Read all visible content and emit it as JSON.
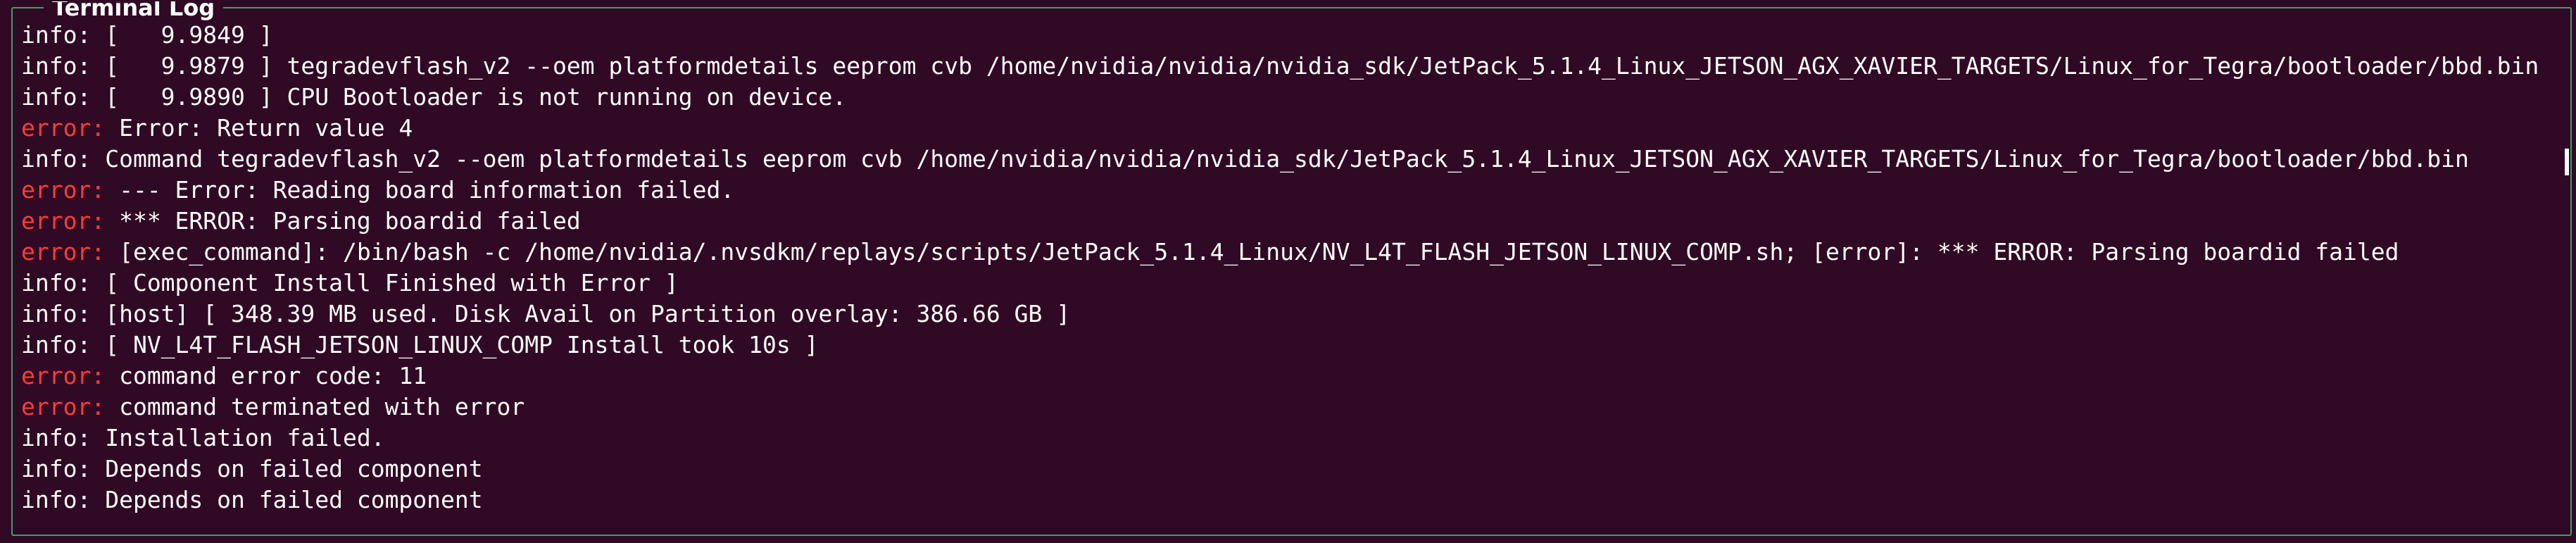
{
  "panel": {
    "title": "Terminal Log"
  },
  "colors": {
    "background": "#300a24",
    "frame_border": "#3a9f6e",
    "info_prefix": "#ffffff",
    "error_prefix": "#ff3b3b",
    "text": "#ffffff"
  },
  "log": {
    "lines": [
      {
        "level": "info",
        "prefix": "info:",
        "text": " [   9.9849 ]"
      },
      {
        "level": "info",
        "prefix": "info:",
        "text": " [   9.9879 ] tegradevflash_v2 --oem platformdetails eeprom cvb /home/nvidia/nvidia/nvidia_sdk/JetPack_5.1.4_Linux_JETSON_AGX_XAVIER_TARGETS/Linux_for_Tegra/bootloader/bbd.bin"
      },
      {
        "level": "info",
        "prefix": "info:",
        "text": " [   9.9890 ] CPU Bootloader is not running on device."
      },
      {
        "level": "error",
        "prefix": "error:",
        "text": " Error: Return value 4"
      },
      {
        "level": "info",
        "prefix": "info:",
        "text": " Command tegradevflash_v2 --oem platformdetails eeprom cvb /home/nvidia/nvidia/nvidia_sdk/JetPack_5.1.4_Linux_JETSON_AGX_XAVIER_TARGETS/Linux_for_Tegra/bootloader/bbd.bin"
      },
      {
        "level": "error",
        "prefix": "error:",
        "text": " --- Error: Reading board information failed."
      },
      {
        "level": "error",
        "prefix": "error:",
        "text": " *** ERROR: Parsing boardid failed"
      },
      {
        "level": "error",
        "prefix": "error:",
        "text": " [exec_command]: /bin/bash -c /home/nvidia/.nvsdkm/replays/scripts/JetPack_5.1.4_Linux/NV_L4T_FLASH_JETSON_LINUX_COMP.sh; [error]: *** ERROR: Parsing boardid failed"
      },
      {
        "level": "info",
        "prefix": "info:",
        "text": " [ Component Install Finished with Error ]"
      },
      {
        "level": "info",
        "prefix": "info:",
        "text": " [host] [ 348.39 MB used. Disk Avail on Partition overlay: 386.66 GB ]"
      },
      {
        "level": "info",
        "prefix": "info:",
        "text": " [ NV_L4T_FLASH_JETSON_LINUX_COMP Install took 10s ]"
      },
      {
        "level": "error",
        "prefix": "error:",
        "text": " command error code: 11"
      },
      {
        "level": "error",
        "prefix": "error:",
        "text": " command terminated with error"
      },
      {
        "level": "info",
        "prefix": "info:",
        "text": " Installation failed."
      },
      {
        "level": "info",
        "prefix": "info:",
        "text": " Depends on failed component"
      },
      {
        "level": "info",
        "prefix": "info:",
        "text": " Depends on failed component"
      }
    ]
  }
}
